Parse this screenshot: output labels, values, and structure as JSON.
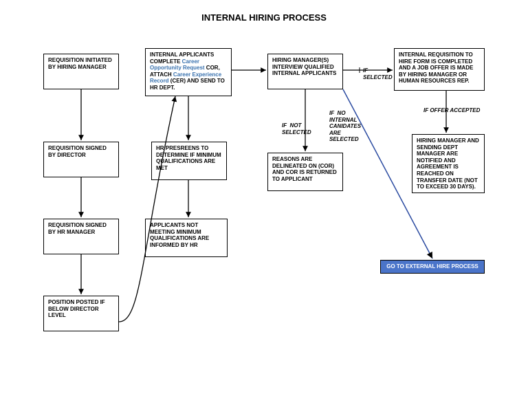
{
  "title": "INTERNAL HIRING PROCESS",
  "boxes": {
    "b1": "REQUISITION INITIATED BY HIRING MANAGER",
    "b2": "REQUISITION SIGNED BY DIRECTOR",
    "b3": "REQUISITION SIGNED BY HR MANAGER",
    "b4": "POSITION POSTED IF BELOW DIRECTOR LEVEL",
    "b5_pre": "INTERNAL APPLICANTS COMPLETE ",
    "b5_link1": "Career Opportunity Request",
    "b5_mid": " COR, ATTACH ",
    "b5_link2": "Career Experience Record",
    "b5_post": " (CER) AND SEND TO HR DEPT.",
    "b6": "HR PRESREENS TO DETERMINE IF MINIMUM QUALIFICATIONS ARE MET",
    "b7": "APPLICANTS NOT MEETING MINIMUM QUALIFICATIONS ARE INFORMED BY HR",
    "b8": "HIRING MANAGER(S) INTERVIEW QUALIFIED INTERNAL APPLICANTS",
    "b9": "REASONS ARE DELINEATED ON (COR) AND COR IS RETURNED TO APPLICANT",
    "b10": "INTERNAL REQUISITION TO HIRE FORM IS COMPLETED AND A JOB OFFER IS MADE BY HIRING MANAGER OR HUMAN RESOURCES REP.",
    "b11": "HIRING MANAGER AND SENDING DEPT MANAGER ARE NOTIFIED AND AGREEMENT IS REACHED ON TRANSFER DATE (NOT TO EXCEED 30 DAYS).",
    "b12": "GO TO EXTERNAL HIRE PROCESS"
  },
  "labels": {
    "ifSelected": "IF\nSELECTED",
    "ifNotSelected": "IF  NOT\nSELECTED",
    "ifNoInternal": "IF  NO\nINTERNAL\nCANIDATES\nARE\nSELECTED",
    "ifOfferAccepted": "IF OFFER ACCEPTED"
  }
}
